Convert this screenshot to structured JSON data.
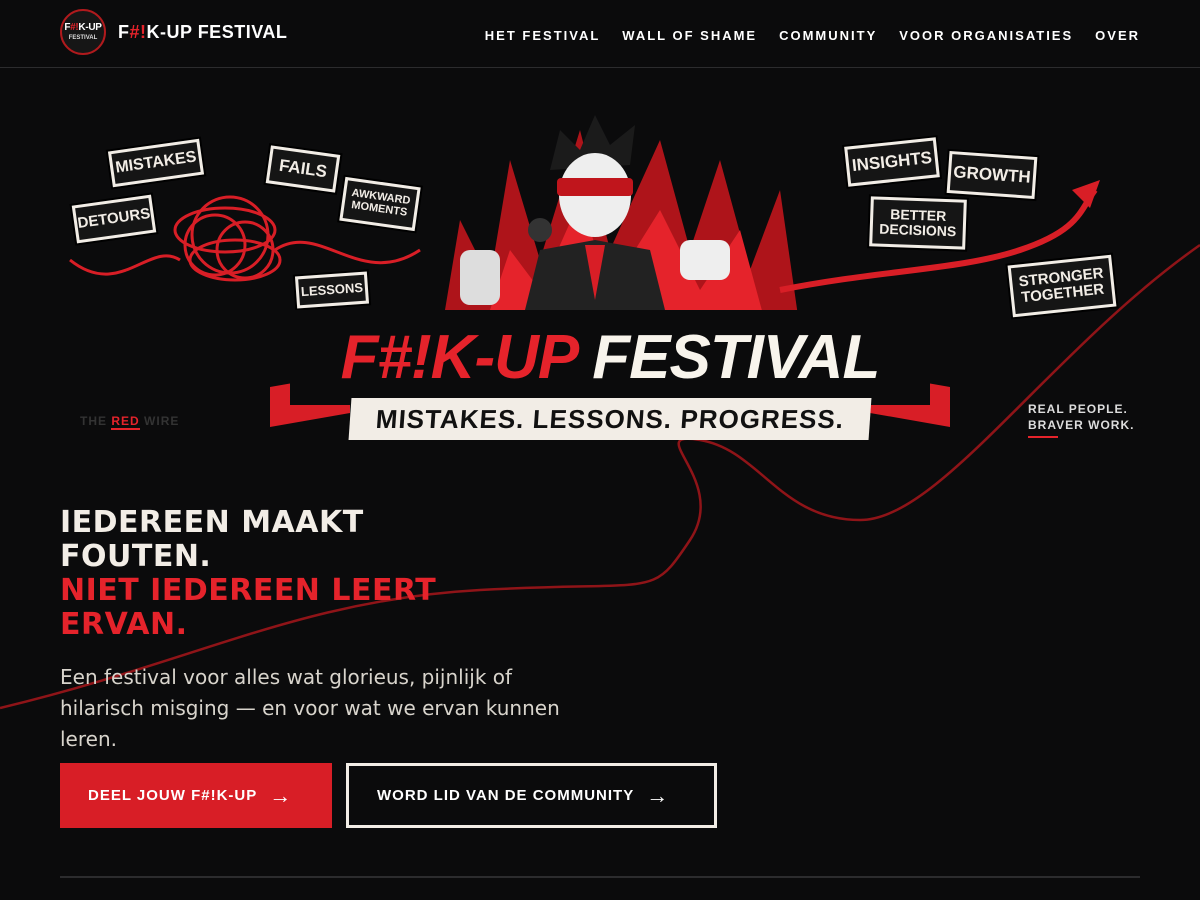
{
  "brand": {
    "logo_line1_prefix": "F",
    "logo_line1_highlight": "#!",
    "logo_line1_suffix": "K-UP",
    "logo_line2": "FESTIVAL",
    "name_prefix": "F",
    "name_highlight": "#!",
    "name_suffix": "K-UP FESTIVAL"
  },
  "nav": {
    "items": [
      {
        "label": "HET FESTIVAL"
      },
      {
        "label": "WALL OF SHAME"
      },
      {
        "label": "COMMUNITY"
      },
      {
        "label": "VOOR ORGANISATIES"
      },
      {
        "label": "OVER"
      }
    ]
  },
  "banner": {
    "signs": {
      "mistakes": "MISTAKES",
      "detours": "DETOURS",
      "fails": "FAILS",
      "awkward_moments": "AWKWARD MOMENTS",
      "lessons": "LESSONS",
      "insights": "INSIGHTS",
      "growth": "GROWTH",
      "better_decisions": "BETTER DECISIONS",
      "stronger_together": "STRONGER TOGETHER"
    },
    "title_red": "F#!K-UP",
    "title_white": "FESTIVAL",
    "ribbon": "MISTAKES. LESSONS. PROGRESS.",
    "left_tag_pre": "THE",
    "left_tag_red": "RED",
    "left_tag_post": "WIRE",
    "right_tag_line1": "REAL PEOPLE.",
    "right_tag_line2": "BRAVER WORK."
  },
  "hero": {
    "headline_line1": "IEDEREEN MAAKT FOUTEN.",
    "headline_line2": "NIET IEDEREEN LEERT ERVAN.",
    "subtitle": "Een festival voor alles wat glorieus, pijnlijk of hilarisch misging — en voor wat we ervan kunnen leren.",
    "primary_cta": "DEEL JOUW F#!K-UP",
    "secondary_cta": "WORD LID VAN DE COMMUNITY"
  },
  "colors": {
    "background": "#0b0b0c",
    "accent_red": "#d81e26",
    "text_light": "#f2ede6"
  },
  "icons": [
    "arrow-right-icon",
    "red-wire-decoration"
  ]
}
